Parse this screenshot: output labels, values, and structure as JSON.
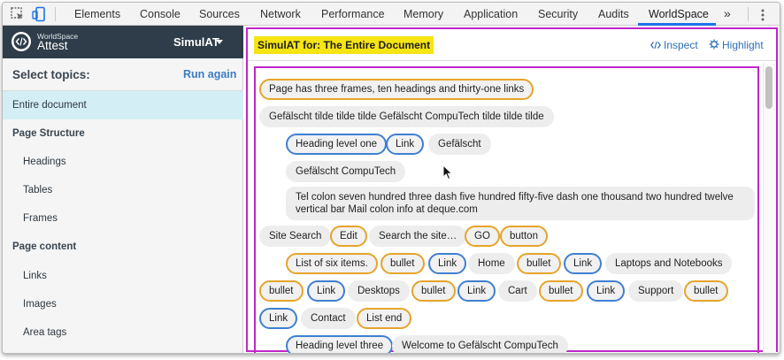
{
  "devtools": {
    "tabs": [
      "Elements",
      "Console",
      "Sources",
      "Network",
      "Performance",
      "Memory",
      "Application",
      "Security",
      "Audits",
      "WorldSpace"
    ],
    "active_tab": "WorldSpace",
    "more": "»",
    "accent": "#1a73e8"
  },
  "brand": {
    "small": "WorldSpace",
    "big": "Attest",
    "product": "SimulAT",
    "bar_color": "#2e3d49"
  },
  "sidebar": {
    "title": "Select topics:",
    "run_again": "Run again",
    "items": [
      {
        "label": "Entire document",
        "selected": true,
        "level": 0
      },
      {
        "label": "Page Structure",
        "level": 0,
        "bold": true
      },
      {
        "label": "Headings",
        "level": 1
      },
      {
        "label": "Tables",
        "level": 1
      },
      {
        "label": "Frames",
        "level": 1
      },
      {
        "label": "Page content",
        "level": 0,
        "bold": true
      },
      {
        "label": "Links",
        "level": 1
      },
      {
        "label": "Images",
        "level": 1
      },
      {
        "label": "Area tags",
        "level": 1
      }
    ]
  },
  "main": {
    "title": "SimulAT for: The Entire Document",
    "inspect": "Inspect",
    "highlight": "Highlight",
    "highlight_color": "#f6e413",
    "frame_color": "#c026c9"
  },
  "chips": [
    {
      "text": "Page has three frames, ten headings and thirty-one links",
      "style": "orange"
    },
    {
      "text": "Gefälscht tilde tilde tilde Gefälscht CompuTech tilde tilde tilde",
      "style": "plain"
    },
    {
      "text": "Heading level one",
      "style": "blue"
    },
    {
      "text": "Link",
      "style": "blue"
    },
    {
      "text": "Gefälscht",
      "style": "plain"
    },
    {
      "text": "Gefälscht CompuTech",
      "style": "plain"
    },
    {
      "text": "Tel colon seven hundred three dash five hundred fifty-five dash one thousand two hundred twelve vertical bar Mail colon info at deque.com",
      "style": "plain"
    },
    {
      "text": "Site Search",
      "style": "plain"
    },
    {
      "text": "Edit",
      "style": "orange"
    },
    {
      "text": "Search the site…",
      "style": "plain"
    },
    {
      "text": "GO",
      "style": "orange"
    },
    {
      "text": "button",
      "style": "orange"
    },
    {
      "text": "List of six items.",
      "style": "orange"
    },
    {
      "text": "bullet",
      "style": "orange"
    },
    {
      "text": "Link",
      "style": "blue"
    },
    {
      "text": "Home",
      "style": "plain"
    },
    {
      "text": "bullet",
      "style": "orange"
    },
    {
      "text": "Link",
      "style": "blue"
    },
    {
      "text": "Laptops and Notebooks",
      "style": "plain"
    },
    {
      "text": "bullet",
      "style": "orange"
    },
    {
      "text": "Link",
      "style": "blue"
    },
    {
      "text": "Desktops",
      "style": "plain"
    },
    {
      "text": "bullet",
      "style": "orange"
    },
    {
      "text": "Link",
      "style": "blue"
    },
    {
      "text": "Cart",
      "style": "plain"
    },
    {
      "text": "bullet",
      "style": "orange"
    },
    {
      "text": "Link",
      "style": "blue"
    },
    {
      "text": "Support",
      "style": "plain"
    },
    {
      "text": "bullet",
      "style": "orange"
    },
    {
      "text": "Link",
      "style": "blue"
    },
    {
      "text": "Contact",
      "style": "plain"
    },
    {
      "text": "List end",
      "style": "orange"
    },
    {
      "text": "Heading level three",
      "style": "blue"
    },
    {
      "text": "Welcome to Gefälscht CompuTech",
      "style": "plain"
    }
  ]
}
